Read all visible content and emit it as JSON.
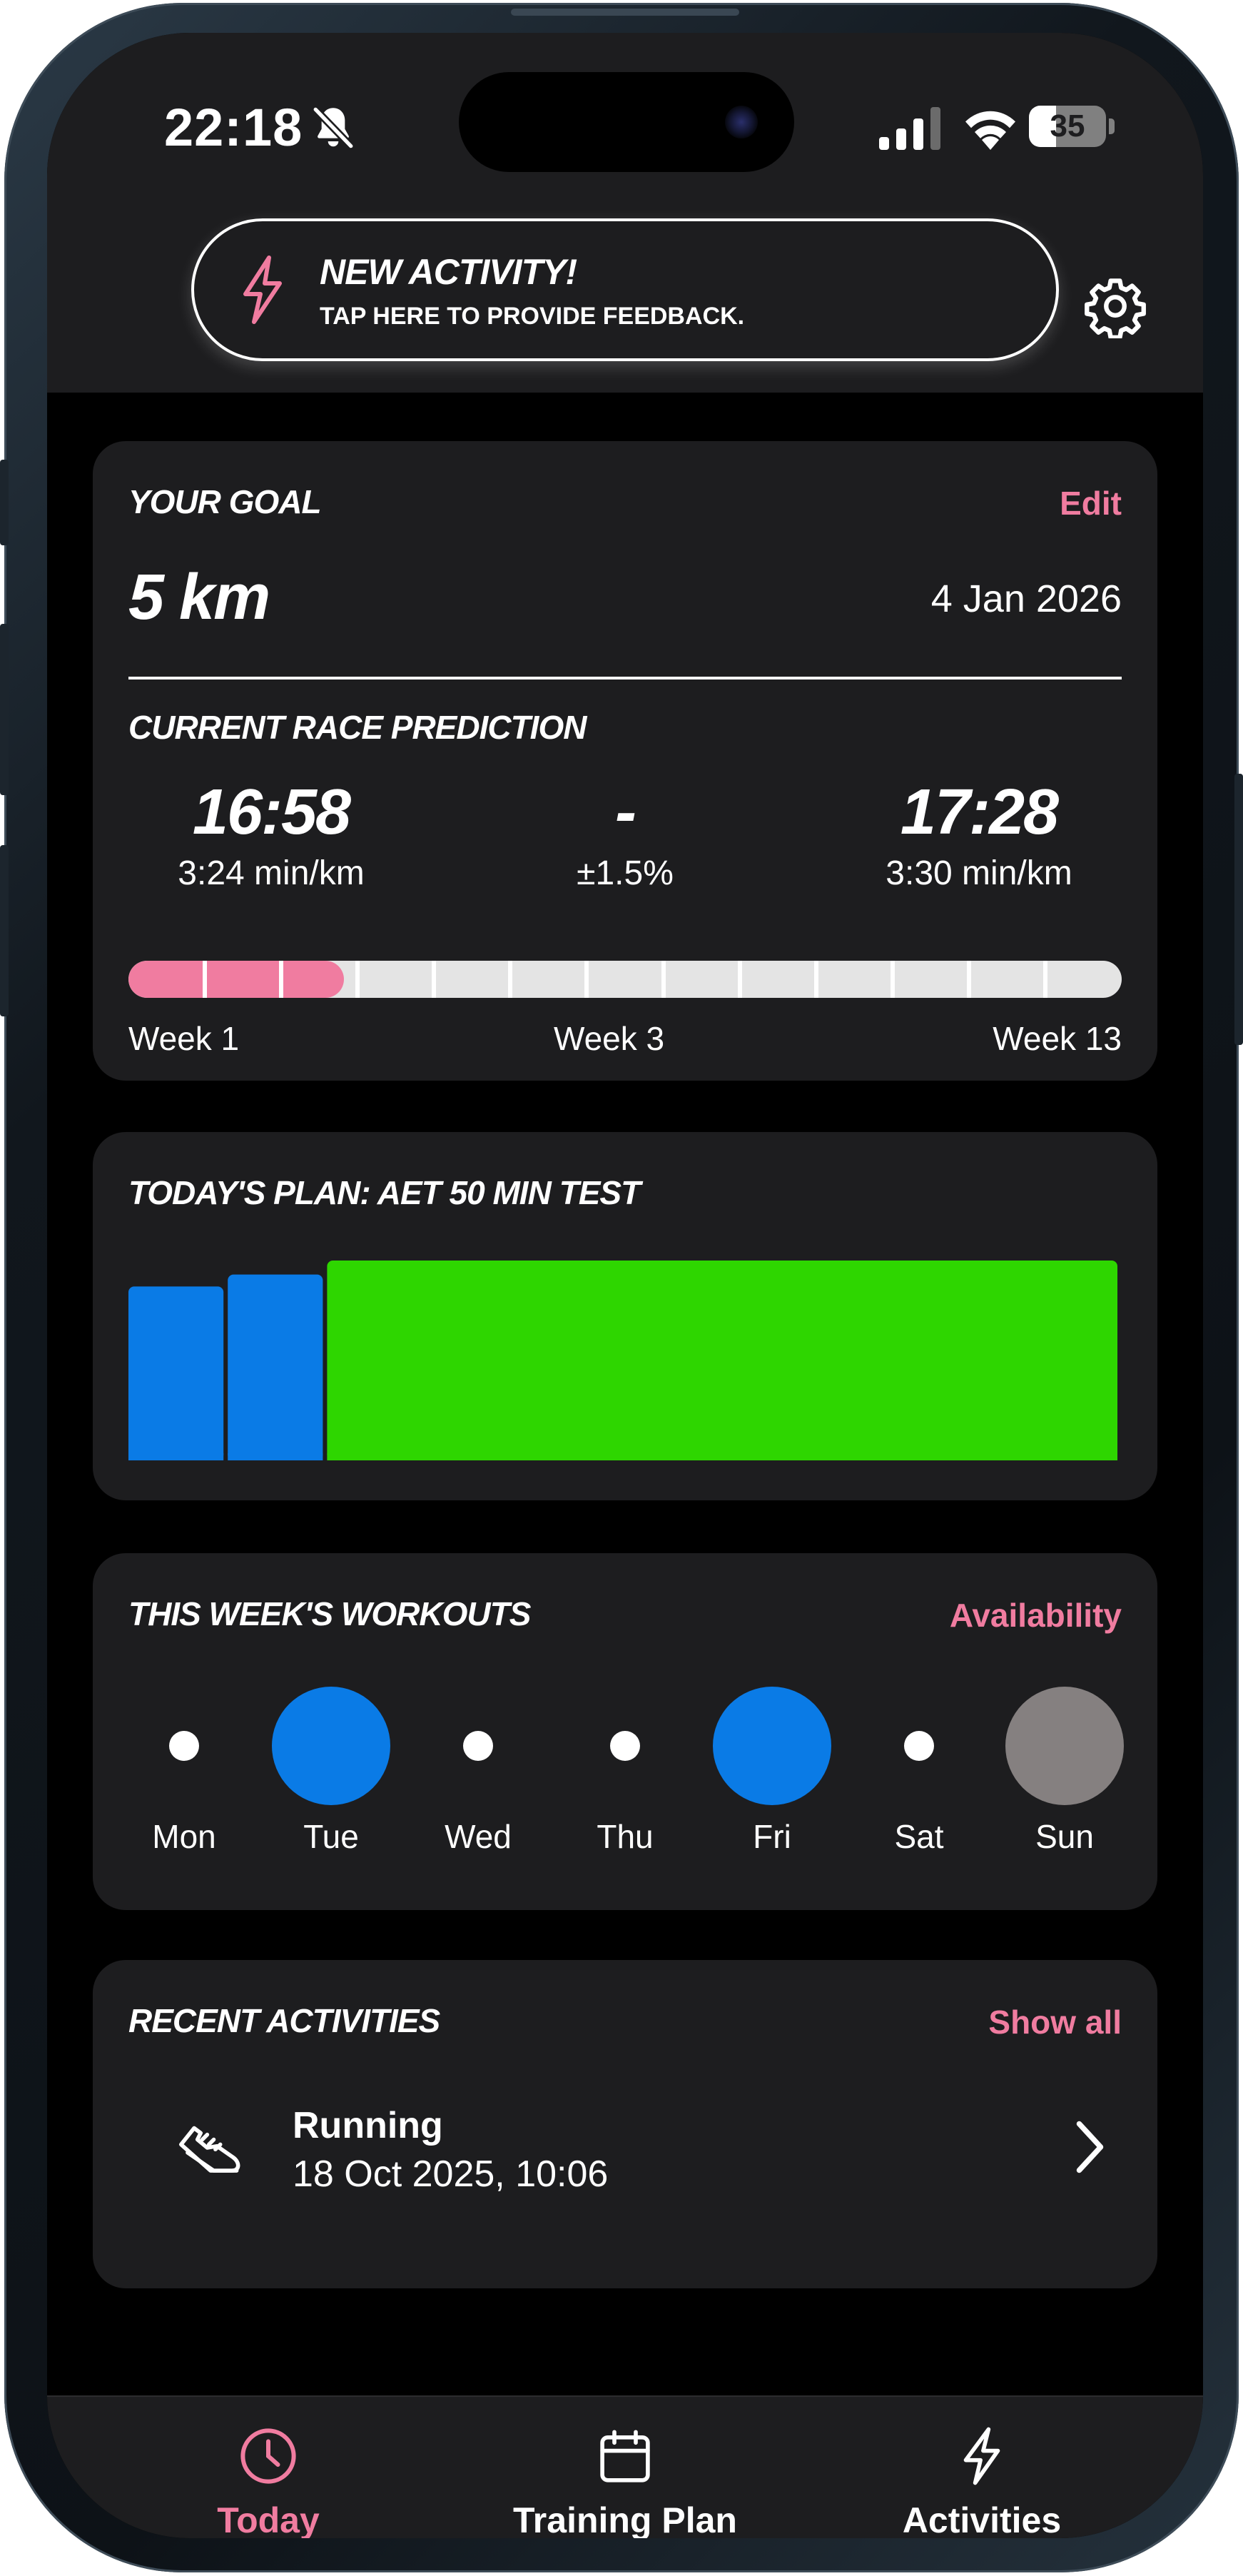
{
  "status_bar": {
    "time": "22:18",
    "battery": "35",
    "battery_level": 0.35
  },
  "banner": {
    "title": "NEW ACTIVITY!",
    "subtitle": "TAP HERE TO PROVIDE FEEDBACK."
  },
  "goal": {
    "title": "YOUR GOAL",
    "edit_label": "Edit",
    "distance": "5 km",
    "date": "4 Jan 2026",
    "prediction_title": "CURRENT RACE PREDICTION",
    "best_time": "16:58",
    "best_pace": "3:24 min/km",
    "separator": "-",
    "uncertainty": "±1.5%",
    "worst_time": "17:28",
    "worst_pace": "3:30 min/km",
    "progress": {
      "current_week": 3,
      "total_weeks": 13,
      "fraction": 0.217
    },
    "week_labels": [
      "Week 1",
      "Week 3",
      "Week 13"
    ]
  },
  "plan": {
    "title": "TODAY'S PLAN: AET 50 MIN TEST",
    "colors": {
      "warmup": "#0a7be6",
      "main": "#2ed600"
    }
  },
  "chart_data": {
    "type": "bar",
    "title": "",
    "segments": [
      {
        "duration": 10,
        "intensity": 0.87,
        "color": "#0a7be6"
      },
      {
        "duration": 10,
        "intensity": 0.93,
        "color": "#0a7be6"
      },
      {
        "duration": 80,
        "intensity": 1.0,
        "color": "#2ed600"
      }
    ]
  },
  "week": {
    "title": "THIS WEEK'S WORKOUTS",
    "availability_label": "Availability",
    "days": [
      {
        "label": "Mon",
        "state": "rest"
      },
      {
        "label": "Tue",
        "state": "planned"
      },
      {
        "label": "Wed",
        "state": "rest"
      },
      {
        "label": "Thu",
        "state": "rest"
      },
      {
        "label": "Fri",
        "state": "planned"
      },
      {
        "label": "Sat",
        "state": "rest"
      },
      {
        "label": "Sun",
        "state": "other"
      }
    ],
    "colors": {
      "planned": "#0a7be6",
      "other": "#858080",
      "rest": "#ffffff"
    }
  },
  "recent": {
    "title": "RECENT ACTIVITIES",
    "show_all_label": "Show all",
    "activities": [
      {
        "name": "Running",
        "datetime": "18 Oct 2025, 10:06"
      }
    ]
  },
  "tabs": [
    {
      "label": "Today",
      "icon": "clock-icon",
      "active": true
    },
    {
      "label": "Training Plan",
      "icon": "calendar-icon",
      "active": false
    },
    {
      "label": "Activities",
      "icon": "bolt-icon",
      "active": false
    }
  ],
  "accent_color": "#f07ca0"
}
